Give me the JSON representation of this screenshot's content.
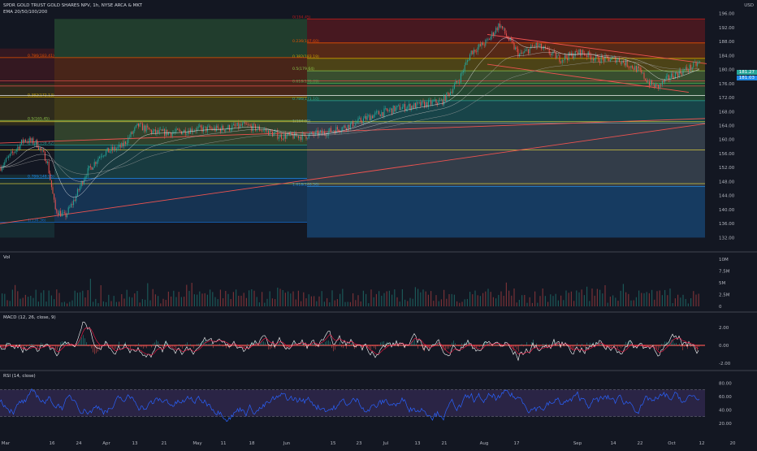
{
  "header": {
    "symbol_line": "SPDR GOLD TRUST GOLD SHARES NPV, 1h, NYSE ARCA & MKT",
    "indicator_line": "EMA 20/50/100/200",
    "currency": "USD"
  },
  "fib_levels": [
    {
      "label": "0(194.45)",
      "price": 194.45,
      "color": "#b71c1c"
    },
    {
      "label": "0.236(187.60)",
      "price": 187.6,
      "color": "#e65100"
    },
    {
      "label": "0.382(183.19)",
      "price": 183.19,
      "color": "#c8a200"
    },
    {
      "label": "0.5(179.64)",
      "price": 179.64,
      "color": "#8bc34a"
    },
    {
      "label": "0.618(176.09)",
      "price": 176.09,
      "color": "#4caf50"
    },
    {
      "label": "0.786(171.10)",
      "price": 171.1,
      "color": "#26a69a"
    },
    {
      "label": "1(164.69)",
      "price": 164.69,
      "color": "#78909c"
    },
    {
      "label": "1.618(146.56)",
      "price": 146.56,
      "color": "#1e88e5"
    }
  ],
  "fib_levels_left": [
    {
      "label": "0.786(183.41)",
      "price": 183.41
    },
    {
      "label": "0.382(172.13)",
      "price": 172.13
    },
    {
      "label": "0.5(165.45)",
      "price": 165.45
    },
    {
      "label": "0.618(158.42)",
      "price": 158.42
    },
    {
      "label": "0.786(148.95)",
      "price": 148.95
    },
    {
      "label": "1(136.36)",
      "price": 136.36
    }
  ],
  "price_axis": {
    "ticks": [
      "196.00",
      "192.00",
      "188.00",
      "184.00",
      "180.00",
      "176.00",
      "172.00",
      "168.00",
      "164.00",
      "160.00",
      "156.00",
      "152.00",
      "148.00",
      "144.00",
      "140.00",
      "136.00",
      "132.00"
    ],
    "current_price": "181.27",
    "current_price_2": "181.03",
    "min": 130,
    "max": 198
  },
  "volume": {
    "label": "Vol",
    "ticks": [
      "10M",
      "7.5M",
      "5M",
      "2.5M",
      "0"
    ]
  },
  "macd": {
    "label": "MACD (12, 26, close, 9)",
    "ticks": [
      "2.00",
      "0.00",
      "-2.00"
    ]
  },
  "rsi": {
    "label": "RSI (14, close)",
    "ticks": [
      "80.00",
      "60.00",
      "40.00",
      "20.00"
    ],
    "upper": 70,
    "lower": 30
  },
  "time_axis": [
    "Mar",
    "16",
    "24",
    "Apr",
    "13",
    "21",
    "May",
    "11",
    "18",
    "Jun",
    "15",
    "23",
    "Jul",
    "13",
    "21",
    "Aug",
    "17",
    "Sep",
    "14",
    "22",
    "Oct",
    "12",
    "20"
  ],
  "colors": {
    "background": "#131722",
    "bull": "#26a69a",
    "bear": "#ef5350",
    "rsi_line": "#2962ff",
    "macd_line": "#ffffff",
    "signal_line": "#ff1744"
  }
}
